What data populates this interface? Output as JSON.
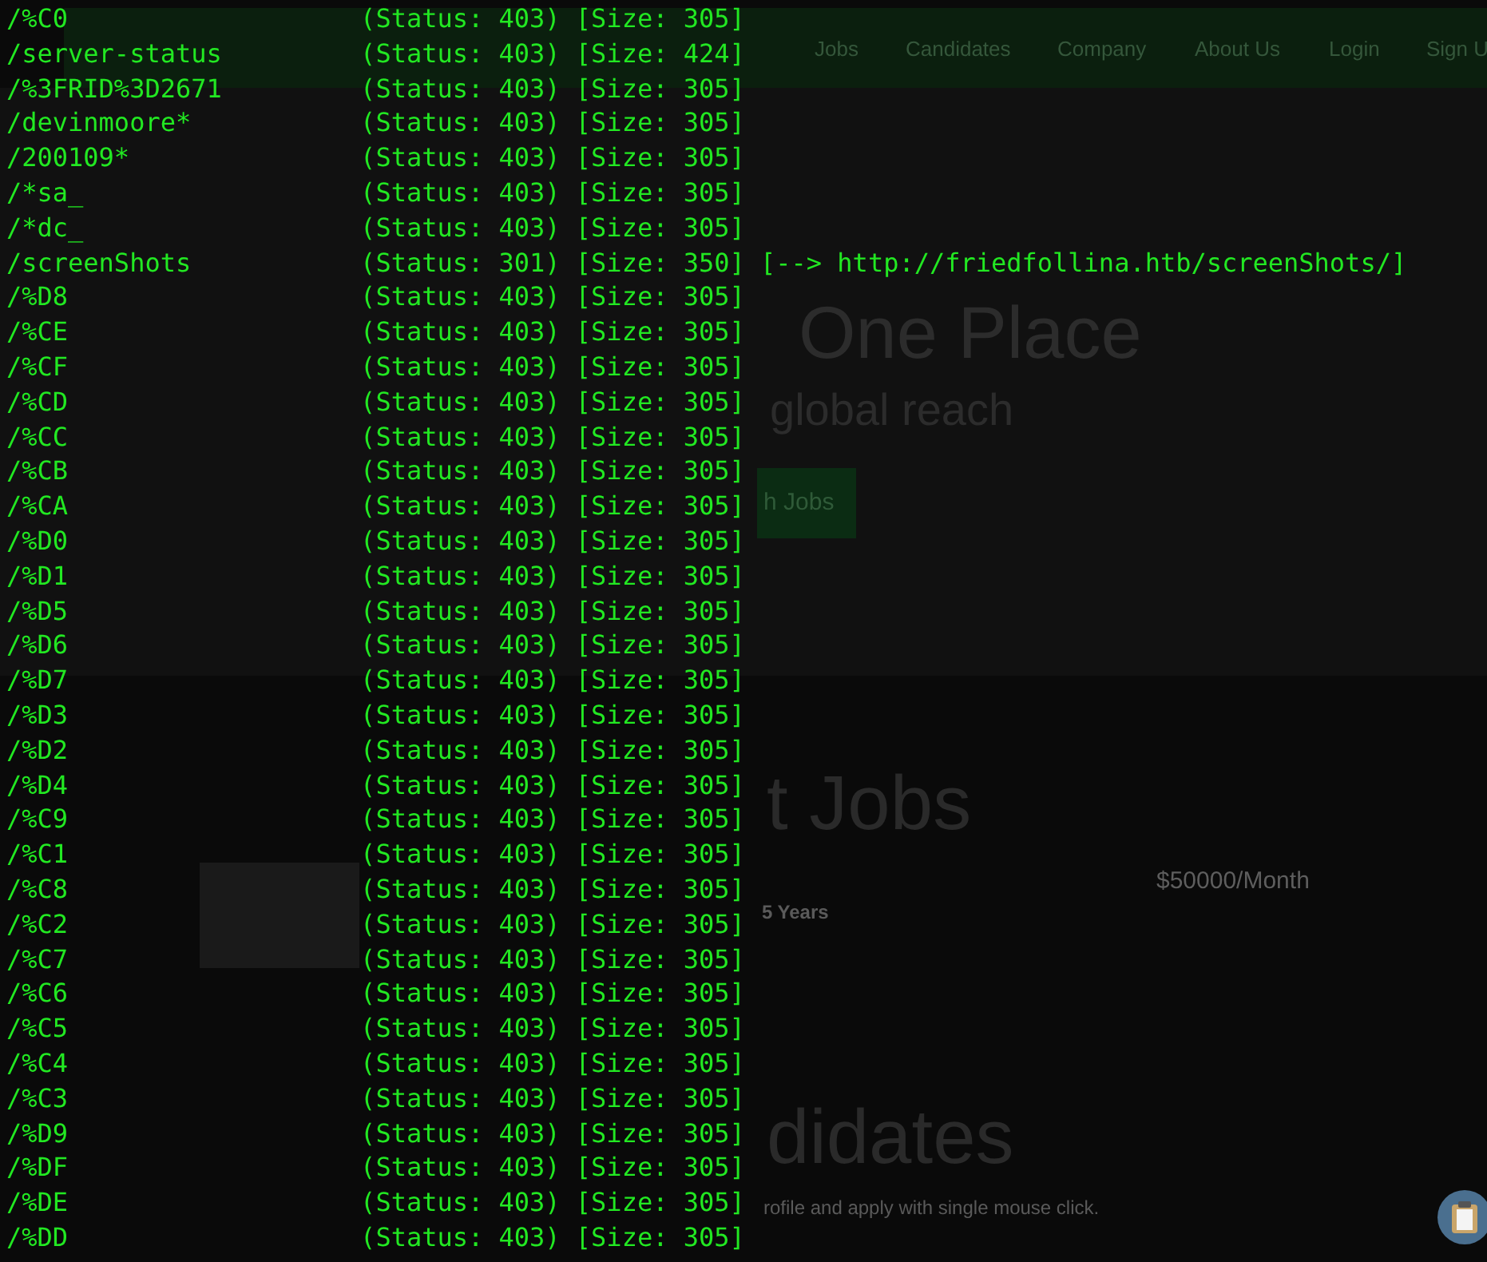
{
  "background_page": {
    "nav": {
      "items": [
        {
          "label": "Jobs"
        },
        {
          "label": "Candidates"
        },
        {
          "label": "Company"
        },
        {
          "label": "About Us"
        },
        {
          "label": "Login"
        },
        {
          "label": "Sign U"
        }
      ]
    },
    "texts": [
      {
        "kind": "heading",
        "text": "One Place"
      },
      {
        "kind": "subheading",
        "text": "global reach"
      },
      {
        "kind": "button",
        "text": "h Jobs"
      },
      {
        "kind": "section",
        "text": "t Jobs"
      },
      {
        "kind": "meta",
        "text": "5 Years"
      },
      {
        "kind": "salary",
        "text": "$50000/Month"
      },
      {
        "kind": "section2",
        "text": "didates"
      },
      {
        "kind": "caption",
        "text": "rofile and apply with single mouse click."
      }
    ]
  },
  "terminal": {
    "lines": [
      "/%C0                   (Status: 403) [Size: 305]",
      "/server-status         (Status: 403) [Size: 424]",
      "/%3FRID%3D2671         (Status: 403) [Size: 305]",
      "/devinmoore*           (Status: 403) [Size: 305]",
      "/200109*               (Status: 403) [Size: 305]",
      "/*sa_                  (Status: 403) [Size: 305]",
      "/*dc_                  (Status: 403) [Size: 305]",
      "/screenShots           (Status: 301) [Size: 350] [--> http://friedfollina.htb/screenShots/]",
      "/%D8                   (Status: 403) [Size: 305]",
      "/%CE                   (Status: 403) [Size: 305]",
      "/%CF                   (Status: 403) [Size: 305]",
      "/%CD                   (Status: 403) [Size: 305]",
      "/%CC                   (Status: 403) [Size: 305]",
      "/%CB                   (Status: 403) [Size: 305]",
      "/%CA                   (Status: 403) [Size: 305]",
      "/%D0                   (Status: 403) [Size: 305]",
      "/%D1                   (Status: 403) [Size: 305]",
      "/%D5                   (Status: 403) [Size: 305]",
      "/%D6                   (Status: 403) [Size: 305]",
      "/%D7                   (Status: 403) [Size: 305]",
      "/%D3                   (Status: 403) [Size: 305]",
      "/%D2                   (Status: 403) [Size: 305]",
      "/%D4                   (Status: 403) [Size: 305]",
      "/%C9                   (Status: 403) [Size: 305]",
      "/%C1                   (Status: 403) [Size: 305]",
      "/%C8                   (Status: 403) [Size: 305]",
      "/%C2                   (Status: 403) [Size: 305]",
      "/%C7                   (Status: 403) [Size: 305]",
      "/%C6                   (Status: 403) [Size: 305]",
      "/%C5                   (Status: 403) [Size: 305]",
      "/%C4                   (Status: 403) [Size: 305]",
      "/%C3                   (Status: 403) [Size: 305]",
      "/%D9                   (Status: 403) [Size: 305]",
      "/%DF                   (Status: 403) [Size: 305]",
      "/%DE                   (Status: 403) [Size: 305]",
      "/%DD                   (Status: 403) [Size: 305]"
    ]
  }
}
